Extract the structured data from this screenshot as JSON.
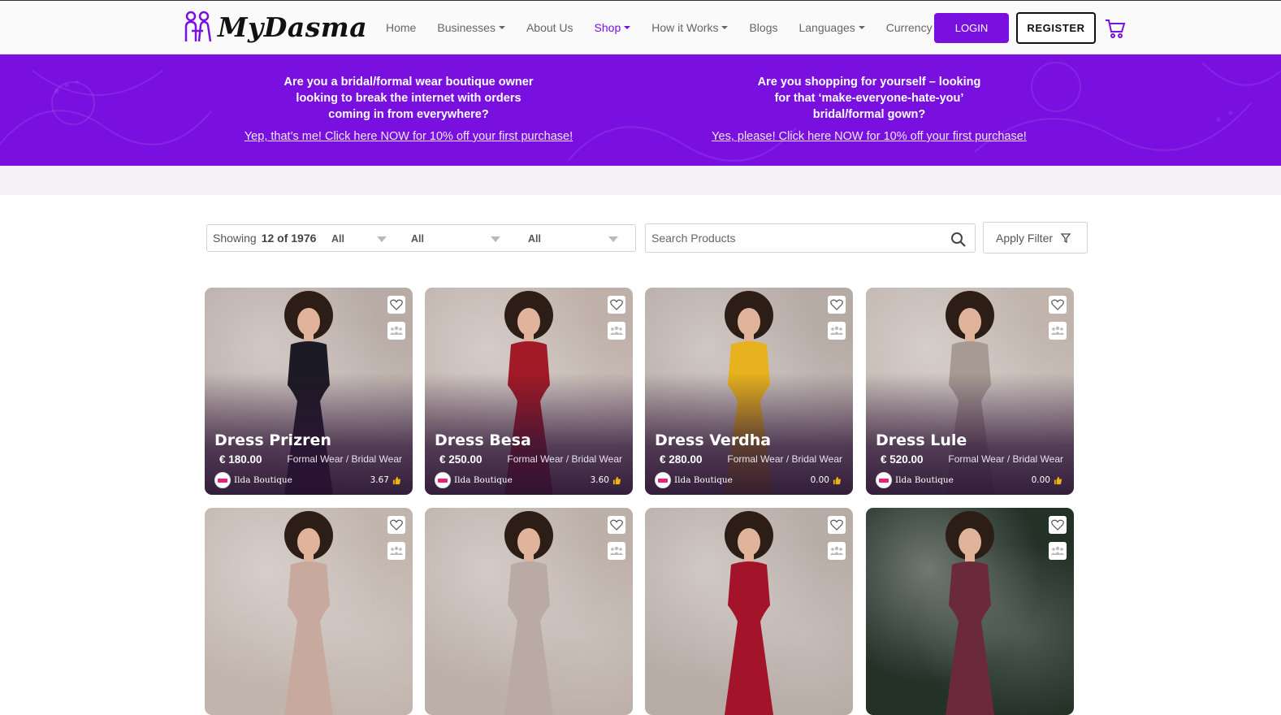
{
  "brand": {
    "name": "MyDasma",
    "accent": "#7a10e0"
  },
  "nav": {
    "items": [
      {
        "label": "Home",
        "dropdown": false,
        "active": false
      },
      {
        "label": "Businesses",
        "dropdown": true,
        "active": false
      },
      {
        "label": "About Us",
        "dropdown": false,
        "active": false
      },
      {
        "label": "Shop",
        "dropdown": true,
        "active": true
      },
      {
        "label": "How it Works",
        "dropdown": true,
        "active": false
      },
      {
        "label": "Blogs",
        "dropdown": false,
        "active": false
      },
      {
        "label": "Languages",
        "dropdown": true,
        "active": false
      },
      {
        "label": "Currency",
        "dropdown": true,
        "active": false
      }
    ],
    "login_label": "LOGIN",
    "register_label": "REGISTER",
    "cart_icon": "cart-icon"
  },
  "banner": {
    "left": {
      "q1": "Are you a bridal/formal wear boutique owner",
      "q2": "looking to break the internet with orders",
      "q3": "coming in from everywhere?",
      "link": "Yep, that’s me! Click here NOW for 10% off your first purchase!"
    },
    "right": {
      "q1": "Are you shopping for yourself – looking",
      "q2": "for that ‘make-everyone-hate-you’",
      "q3": "bridal/formal gown?",
      "link": "Yes, please! Click here NOW for 10% off your first purchase!"
    }
  },
  "filters": {
    "showing_label": "Showing",
    "showing_count": "12 of 1976",
    "select1": "All",
    "select2": "All",
    "select3": "All",
    "search_placeholder": "Search Products",
    "apply_label": "Apply Filter"
  },
  "products": [
    {
      "title": "Dress Prizren",
      "price": "€ 180.00",
      "category": "Formal Wear / Bridal Wear",
      "shop": "Ilda Boutique",
      "rating": "3.67",
      "dress_color": "#1c1a24"
    },
    {
      "title": "Dress Besa",
      "price": "€ 250.00",
      "category": "Formal Wear / Bridal Wear",
      "shop": "Ilda Boutique",
      "rating": "3.60",
      "dress_color": "#a11a26"
    },
    {
      "title": "Dress Verdha",
      "price": "€ 280.00",
      "category": "Formal Wear / Bridal Wear",
      "shop": "Ilda Boutique",
      "rating": "0.00",
      "dress_color": "#e6b21d"
    },
    {
      "title": "Dress Lule",
      "price": "€ 520.00",
      "category": "Formal Wear / Bridal Wear",
      "shop": "Ilda Boutique",
      "rating": "0.00",
      "dress_color": "#a69a93"
    },
    {
      "dress_color": "#c7a99e"
    },
    {
      "dress_color": "#b9aaa3"
    },
    {
      "dress_color": "#a3142a"
    },
    {
      "dress_color": "#6b2a3c"
    }
  ]
}
